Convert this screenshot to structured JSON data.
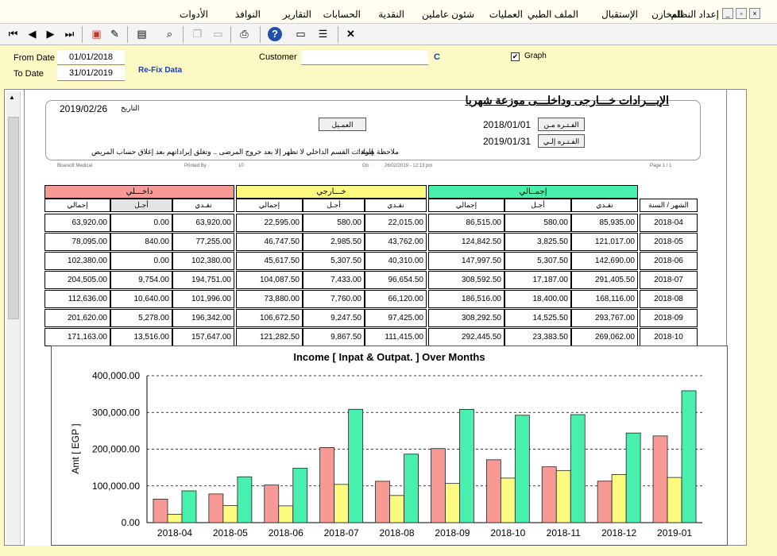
{
  "menu": {
    "items": [
      "إعداد النظام",
      "المخازن",
      "الإستقبال",
      "الملف الطبي",
      "العمليات",
      "شئون عاملين",
      "النقدية",
      "الحسابات",
      "التقارير",
      "النوافذ",
      "الأدوات"
    ]
  },
  "toolbar": {
    "buttons": [
      "first",
      "previous",
      "next",
      "last",
      "export",
      "erase",
      "save",
      "search",
      "copy",
      "paste",
      "print",
      "help",
      "preview",
      "config",
      "close"
    ]
  },
  "filter": {
    "from_label": "From Date",
    "from_value": "01/01/2018",
    "to_label": "To Date",
    "to_value": "31/01/2019",
    "refix_label": "Re-Fix Data",
    "customer_label": "Customer",
    "customer_value": "",
    "customer_button": "C",
    "graph_label": "Graph",
    "graph_checked": true
  },
  "report": {
    "title": "الإيـــرادات خـــارجى وداخلـــى موزعة شهريا",
    "date_label": "التاريخ",
    "date_value": "2019/02/26",
    "customer_label": "العمـيل",
    "period_from_label": "الفـتـره مـن",
    "period_from_value": "2018/01/01",
    "period_to_label": "الفـتـره إلـي",
    "period_to_value": "2019/01/31",
    "note_label": "ملاحظة هامة  :",
    "note_text": "إيرادات القسم الداخلي لا تظهر إلا بعد خروج المرضى .. وتغلق إيراداتهم بعد إغلاق حساب المريض",
    "meta_company": "Bluesoft Medical",
    "meta_printed_by": "Printed By :",
    "meta_user": "10",
    "meta_on": "On :",
    "meta_on_value": "26/02/2019  -  12:13 pm",
    "meta_page": "Page   1  /  1"
  },
  "table": {
    "groups": {
      "inpatient": "داخـــلي",
      "outpatient": "خـــارجي",
      "total": "إجمــالي"
    },
    "col_total": "إجمالي",
    "col_credit": "أجـل",
    "col_cash": "نقـدي",
    "col_month": "الشهر / السنة",
    "rows": [
      [
        "63,920.00",
        "0.00",
        "63,920.00",
        "22,595.00",
        "580.00",
        "22,015.00",
        "86,515.00",
        "580.00",
        "85,935.00",
        "2018-04"
      ],
      [
        "78,095.00",
        "840.00",
        "77,255.00",
        "46,747.50",
        "2,985.50",
        "43,762.00",
        "124,842.50",
        "3,825.50",
        "121,017.00",
        "2018-05"
      ],
      [
        "102,380.00",
        "0.00",
        "102,380.00",
        "45,617.50",
        "5,307.50",
        "40,310.00",
        "147,997.50",
        "5,307.50",
        "142,690.00",
        "2018-06"
      ],
      [
        "204,505.00",
        "9,754.00",
        "194,751.00",
        "104,087.50",
        "7,433.00",
        "96,654.50",
        "308,592.50",
        "17,187.00",
        "291,405.50",
        "2018-07"
      ],
      [
        "112,636.00",
        "10,640.00",
        "101,996.00",
        "73,880.00",
        "7,760.00",
        "66,120.00",
        "186,516.00",
        "18,400.00",
        "168,116.00",
        "2018-08"
      ],
      [
        "201,620.00",
        "5,278.00",
        "196,342.00",
        "106,672.50",
        "9,247.50",
        "97,425.00",
        "308,292.50",
        "14,525.50",
        "293,767.00",
        "2018-09"
      ],
      [
        "171,163.00",
        "13,516.00",
        "157,647.00",
        "121,282.50",
        "9,867.50",
        "111,415.00",
        "292,445.50",
        "23,383.50",
        "269,062.00",
        "2018-10"
      ]
    ]
  },
  "colors": {
    "inpatient": "#f79a96",
    "outpatient": "#fdfa80",
    "total": "#47f0ac"
  },
  "chart_data": {
    "type": "bar",
    "title": "Income [ Inpat & Outpat. ] Over Months",
    "ylabel": "Amt [ EGP ]",
    "xlabel": "",
    "ylim": [
      0,
      400000
    ],
    "yticks": [
      "0.00",
      "100,000.00",
      "200,000.00",
      "300,000.00",
      "400,000.00"
    ],
    "grid": true,
    "categories": [
      "2018-04",
      "2018-05",
      "2018-06",
      "2018-07",
      "2018-08",
      "2018-09",
      "2018-10",
      "2018-11",
      "2018-12",
      "2019-01"
    ],
    "series": [
      {
        "values": [
          63920,
          78095,
          102380,
          204505,
          112636,
          201620,
          171163,
          152000,
          113000,
          236000
        ]
      },
      {
        "values": [
          22595,
          46747.5,
          45617.5,
          104087.5,
          73880,
          106672.5,
          121282.5,
          142000,
          131000,
          123000
        ]
      },
      {
        "values": [
          86515,
          124842.5,
          147997.5,
          308592.5,
          186516,
          308292.5,
          292445.5,
          294000,
          244000,
          359000
        ]
      }
    ]
  }
}
